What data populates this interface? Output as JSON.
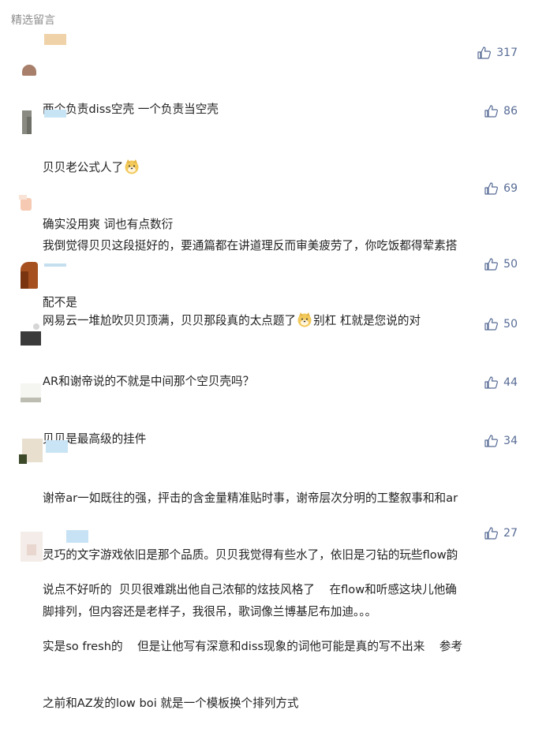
{
  "section": {
    "title": "精选留言"
  },
  "comments": [
    {
      "likes": "317",
      "lines": [
        "两个负责diss空壳 一个负责当空壳"
      ]
    },
    {
      "likes": "86",
      "lines": [
        "贝贝老公式人了",
        "确实没用爽 词也有点数衍"
      ],
      "emoji_after_line": 0
    },
    {
      "likes": "69",
      "lines": [
        "我倒觉得贝贝这段挺好的，要通篇都在讲道理反而审美疲劳了，你吃饭都得荤素搭",
        "配不是"
      ]
    },
    {
      "likes": "50",
      "lines": [
        "网易云一堆尬吹贝贝顶满，贝贝那段真的太点题了",
        "别杠 杠就是您说的对"
      ],
      "emoji_between": true
    },
    {
      "likes": "50",
      "lines": [
        "AR和谢帝说的不就是中间那个空贝壳吗？"
      ]
    },
    {
      "likes": "44",
      "lines": [
        "贝贝是最高级的挂件"
      ]
    },
    {
      "likes": "34",
      "lines": [
        "谢帝ar一如既往的强，抨击的含金量精准贴时事，谢帝层次分明的工整叙事和和ar",
        "灵巧的文字游戏依旧是那个品质。贝贝我觉得有些水了，依旧是刁钻的玩些flow韵",
        "脚排列，但内容还是老样子，我很吊，歌词像兰博基尼布加迪。。。"
      ]
    },
    {
      "likes": "27",
      "lines": [
        "说点不好听的  贝贝很难跳出他自己浓郁的炫技风格了    在flow和听感这块儿他确",
        "实是so fresh的    但是让他写有深意和diss现象的词他可能是真的写不出来    参考",
        "之前和AZ发的low boi 就是一个模板换个排列方式"
      ]
    }
  ]
}
